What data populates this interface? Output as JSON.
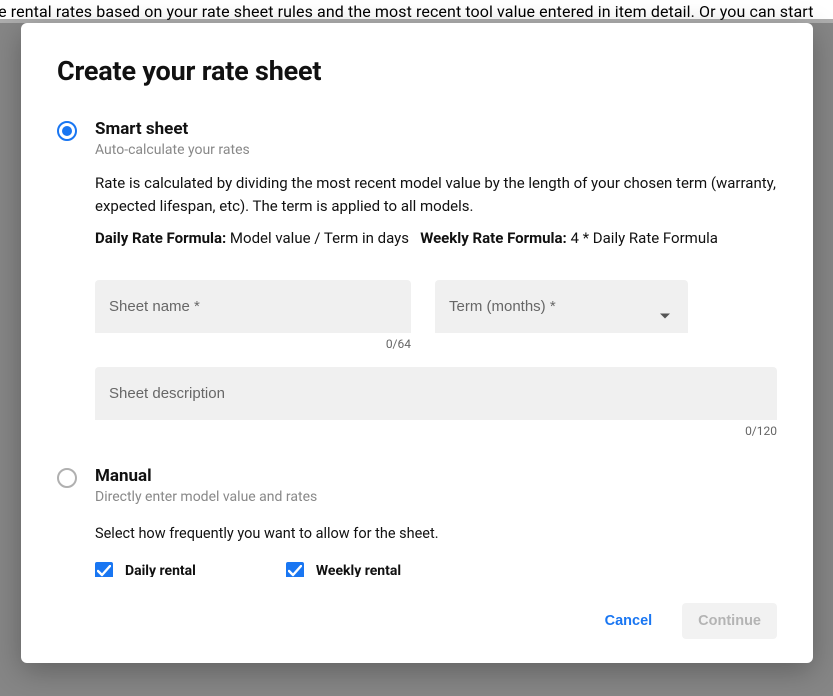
{
  "background_text": "late rental rates based on your rate sheet rules and the most recent tool value entered in item detail. Or you can start",
  "modal": {
    "title": "Create your rate sheet",
    "smart": {
      "title": "Smart sheet",
      "subtitle": "Auto-calculate your rates",
      "description": "Rate is calculated by dividing the most recent model value by the length of your chosen term (warranty, expected lifespan, etc). The term is applied to all models.",
      "daily_label": "Daily Rate Formula:",
      "daily_value": " Model value / Term in days",
      "weekly_label": "Weekly Rate Formula:",
      "weekly_value": " 4 * Daily Rate Formula",
      "sheet_name_placeholder": "Sheet name *",
      "sheet_name_counter": "0/64",
      "term_placeholder": "Term (months) *",
      "desc_placeholder": "Sheet description",
      "desc_counter": "0/120",
      "selected": true
    },
    "manual": {
      "title": "Manual",
      "subtitle": "Directly enter model value and rates",
      "selected": false
    },
    "freq_text": "Select how frequently you want to allow for the sheet.",
    "cb_daily": "Daily rental",
    "cb_weekly": "Weekly rental",
    "cancel": "Cancel",
    "continue": "Continue"
  }
}
